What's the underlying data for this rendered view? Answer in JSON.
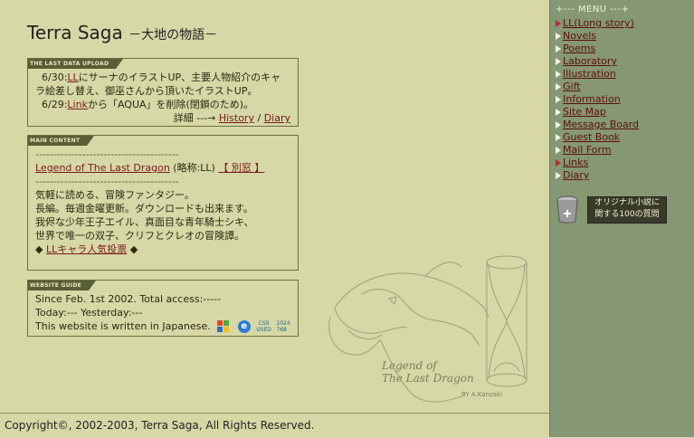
{
  "header": {
    "title": "Terra Saga",
    "subtitle": "－大地の物語－"
  },
  "upload_box": {
    "heading": "THE LAST DATA UPLOAD",
    "line1_date": "6/30:",
    "line1_link": "LL",
    "line1_text": "にサーナのイラストUP、主要人物紹介のキャラ絵差し替え、御巫さんから頂いたイラストUP。",
    "line2_date": "6/29:",
    "line2_link": "Link",
    "line2_text": "から「AQUA」を削除(閉鎖のため)。",
    "detail_label": "詳細 ---→",
    "history_link": "History",
    "separator": "/",
    "diary_link": "Diary"
  },
  "content_box": {
    "heading": "MAIN CONTENT",
    "dashes": "----------------------------------------",
    "story_link": "Legend of The Last Dragon",
    "story_abbr": "(略称:LL)",
    "window_link": "【 別窓 】",
    "desc1": "気軽に読める、冒険ファンタジー。",
    "desc2": "長編。毎週金曜更新。ダウンロードも出来ます。",
    "desc3": "我侭な少年王子エイル、真面目な青年騎士シキ、",
    "desc4": "世界で唯一の双子、クリフとクレオの冒険譚。",
    "vote_bullet": "◆",
    "vote_link": "LLキャラ人気投票",
    "vote_bullet_end": "◆"
  },
  "guide_box": {
    "heading": "WEBSITE GUIDE",
    "line1": "Since Feb. 1st 2002. Total access:-----",
    "line2": "Today:--- Yesterday:---",
    "line3": "This website is written in Japanese.",
    "ie_glyph": "e",
    "css_line1": "CSS",
    "css_line2": "USED",
    "res_line1": "1024",
    "res_line2": "768"
  },
  "illustration": {
    "caption1": "Legend of",
    "caption2": "The Last Dragon",
    "signature": "BY A.Kanzaki"
  },
  "footer": {
    "copyright": "Copyright©, 2002-2003, Terra Saga, All Rights Reserved."
  },
  "sidebar": {
    "menu_title": "+--- MENU ---+",
    "items": [
      {
        "label": "LL(Long story)"
      },
      {
        "label": "Novels"
      },
      {
        "label": "Poems"
      },
      {
        "label": "Laboratory"
      },
      {
        "label": "Illustration"
      },
      {
        "label": "Gift"
      },
      {
        "label": "Information"
      },
      {
        "label": "Site Map"
      },
      {
        "label": "Message Board"
      },
      {
        "label": "Guest Book"
      },
      {
        "label": "Mail Form"
      },
      {
        "label": "Links"
      },
      {
        "label": "Diary"
      }
    ],
    "promo_line1": "オリジナル小説に",
    "promo_line2": "関する100の質問"
  },
  "colors": {
    "background": "#d6d8a6",
    "sidebar": "#869774",
    "link": "#7a1a1a",
    "box_border": "#6d7140"
  }
}
